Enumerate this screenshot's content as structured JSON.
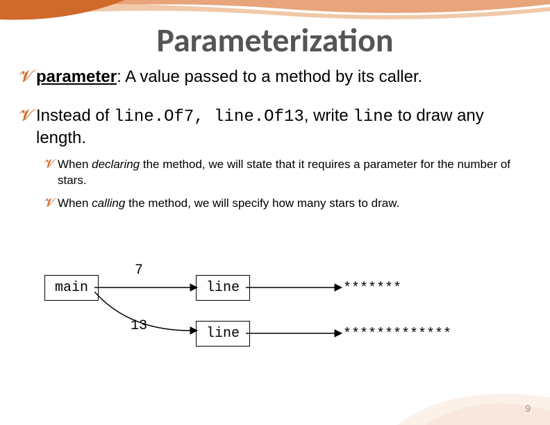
{
  "title": "Parameterization",
  "bullet1": {
    "term": "parameter",
    "rest": ": A value passed to a method by its caller."
  },
  "bullet2": {
    "lead": "Instead of ",
    "c1": "line.Of7",
    "sep": ", ",
    "c2": "line.Of13",
    "mid": ", write ",
    "c3": "line",
    "tail": " to draw any length."
  },
  "sub1": {
    "a": "When ",
    "b": "declaring",
    "c": " the method, we will state that it requires a parameter for the number of stars."
  },
  "sub2": {
    "a": "When ",
    "b": "calling",
    "c": " the method, we will specify how many stars to draw."
  },
  "diagram": {
    "main": "main",
    "line1": "line",
    "line2": "line",
    "n1": "7",
    "n2": "13",
    "stars1": "*******",
    "stars2": "*************"
  },
  "page": "9"
}
